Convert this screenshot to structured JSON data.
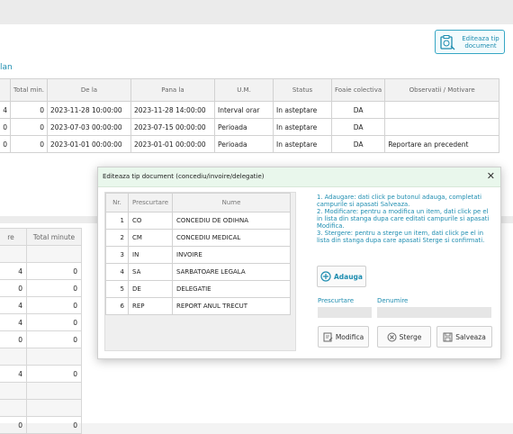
{
  "header": {
    "edit_type_button": "Editeaza tip document",
    "section_title": "lan"
  },
  "main_table": {
    "columns": [
      "Total min.",
      "De la",
      "Pana la",
      "U.M.",
      "Status",
      "Foaie colectiva",
      "Observatii / Motivare"
    ],
    "rows": [
      [
        "4",
        "0",
        "2023-11-28 10:00:00",
        "2023-11-28 14:00:00",
        "Interval orar",
        "In asteptare",
        "DA",
        ""
      ],
      [
        "0",
        "0",
        "2023-07-03 00:00:00",
        "2023-07-15 00:00:00",
        "Perioada",
        "In asteptare",
        "DA",
        ""
      ],
      [
        "0",
        "0",
        "2023-01-01 00:00:00",
        "2023-01-01 00:00:00",
        "Perioada",
        "In asteptare",
        "DA",
        "Reportare an precedent"
      ]
    ]
  },
  "side_table": {
    "columns": [
      "re",
      "Total minute"
    ],
    "rows": [
      [
        "",
        ""
      ],
      [
        "4",
        "0"
      ],
      [
        "0",
        "0"
      ],
      [
        "4",
        "0"
      ],
      [
        "4",
        "0"
      ],
      [
        "0",
        "0"
      ],
      [
        "",
        ""
      ],
      [
        "4",
        "0"
      ],
      [
        "",
        ""
      ],
      [
        "",
        ""
      ],
      [
        "0",
        "0"
      ]
    ]
  },
  "dialog": {
    "title": "Editeaza tip document (concediu/invoire/delegatie)",
    "close": "✕",
    "columns": [
      "Nr.",
      "Prescurtare",
      "Nume"
    ],
    "rows": [
      [
        "1",
        "CO",
        "CONCEDIU DE ODIHNA"
      ],
      [
        "2",
        "CM",
        "CONCEDIU MEDICAL"
      ],
      [
        "3",
        "IN",
        "INVOIRE"
      ],
      [
        "4",
        "SA",
        "SARBATOARE LEGALA"
      ],
      [
        "5",
        "DE",
        "DELEGATIE"
      ],
      [
        "6",
        "REP",
        "REPORT ANUL TRECUT"
      ]
    ],
    "help": [
      "1. Adaugare: dati click pe butonul adauga, completati campurile si apasati Salveaza.",
      "2. Modificare: pentru a modifica un item, dati click pe el in lista din stanga dupa care editati campurile si apasati Modifica.",
      "3. Stergere: pentru a sterge un item, dati click pe el in lista din stanga dupa care apasati Sterge si confirmati."
    ],
    "add_label": "Adauga",
    "field_prescurtare": "Prescurtare",
    "field_denumire": "Denumire",
    "modify_label": "Modifica",
    "delete_label": "Sterge",
    "save_label": "Salveaza",
    "accent": "#1e8db0"
  }
}
